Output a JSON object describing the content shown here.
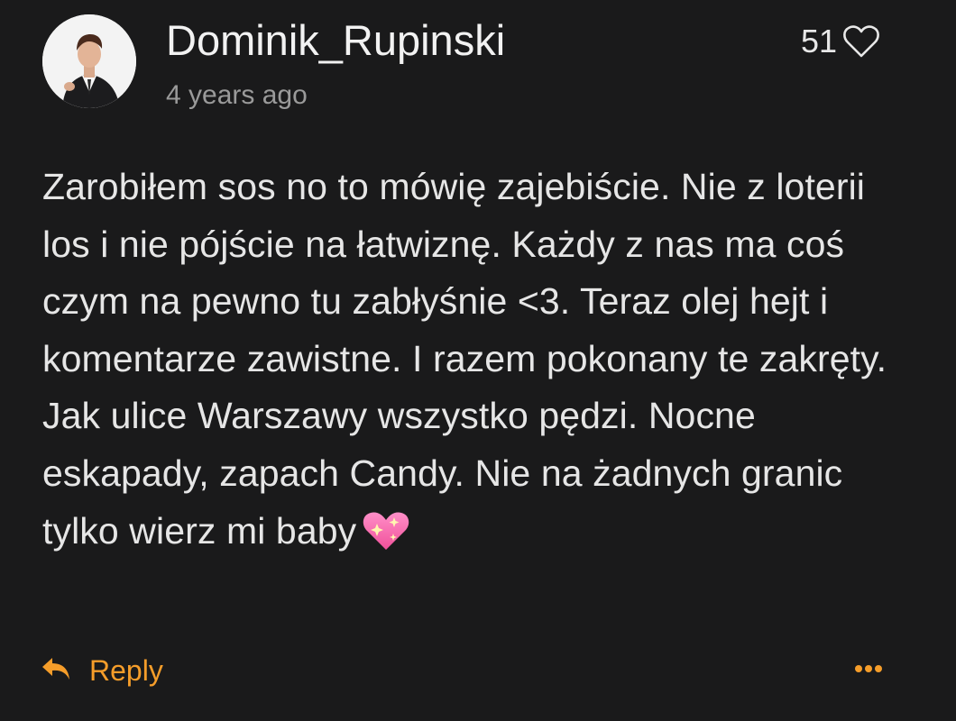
{
  "comment": {
    "author": "Dominik_Rupinski",
    "timestamp": "4 years ago",
    "likes": "51",
    "text": "Zarobiłem sos no to mówię zajebiście. Nie z loterii los i nie pójście na łatwiznę. Każdy z nas ma coś czym na pewno tu zabłyśnie <3. Teraz olej hejt i komentarze zawistne. I razem pokonany te zakręty. Jak ulice Warszawy wszystko pędzi. Nocne eskapady, zapach Candy. Nie na żadnych granic tylko wierz mi baby"
  },
  "actions": {
    "reply_label": "Reply"
  },
  "icons": {
    "like": "heart-outline-icon",
    "emoji": "sparkling-heart-icon",
    "reply": "reply-arrow-icon",
    "more": "more-options-icon"
  },
  "colors": {
    "background": "#1a1a1b",
    "accent": "#f59d2a",
    "text": "#e6e6e6",
    "muted": "#9a9a9a"
  }
}
